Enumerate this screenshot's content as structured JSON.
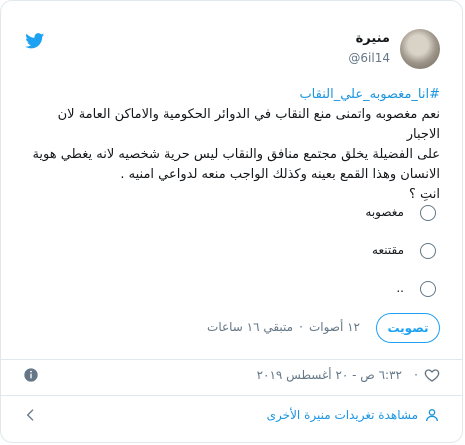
{
  "user": {
    "name": "منيرة",
    "handle": "@6il14"
  },
  "tweet": {
    "hashtag": "#انا_مغصوبه_علي_النقاب",
    "lines": [
      "نعم مغصوبه واتمنى منع النقاب في الدوائر الحكومية والاماكن العامة لان الاجبار",
      "على الفضيلة يخلق مجتمع منافق والنقاب ليس حرية شخصيه لانه يغطي هوية",
      "الانسان وهذا القمع بعينه وكذلك الواجب منعه لدواعي امنيه .",
      "انتِ ؟"
    ]
  },
  "poll": {
    "options": [
      "مغصوبه",
      "مقتنعه",
      ".."
    ],
    "vote_label": "تصويت",
    "votes": "١٢ أصوات",
    "remaining": "متبقي ١٦ ساعات"
  },
  "footer": {
    "separator": "·",
    "timestamp": "٦:٣٢ ص - ٢٠ أغسطس ٢٠١٩"
  },
  "more_link": "مشاهدة تغريدات منيرة الأخرى",
  "colors": {
    "link": "#1b95e0",
    "accent": "#1da1f2",
    "muted": "#657786"
  }
}
